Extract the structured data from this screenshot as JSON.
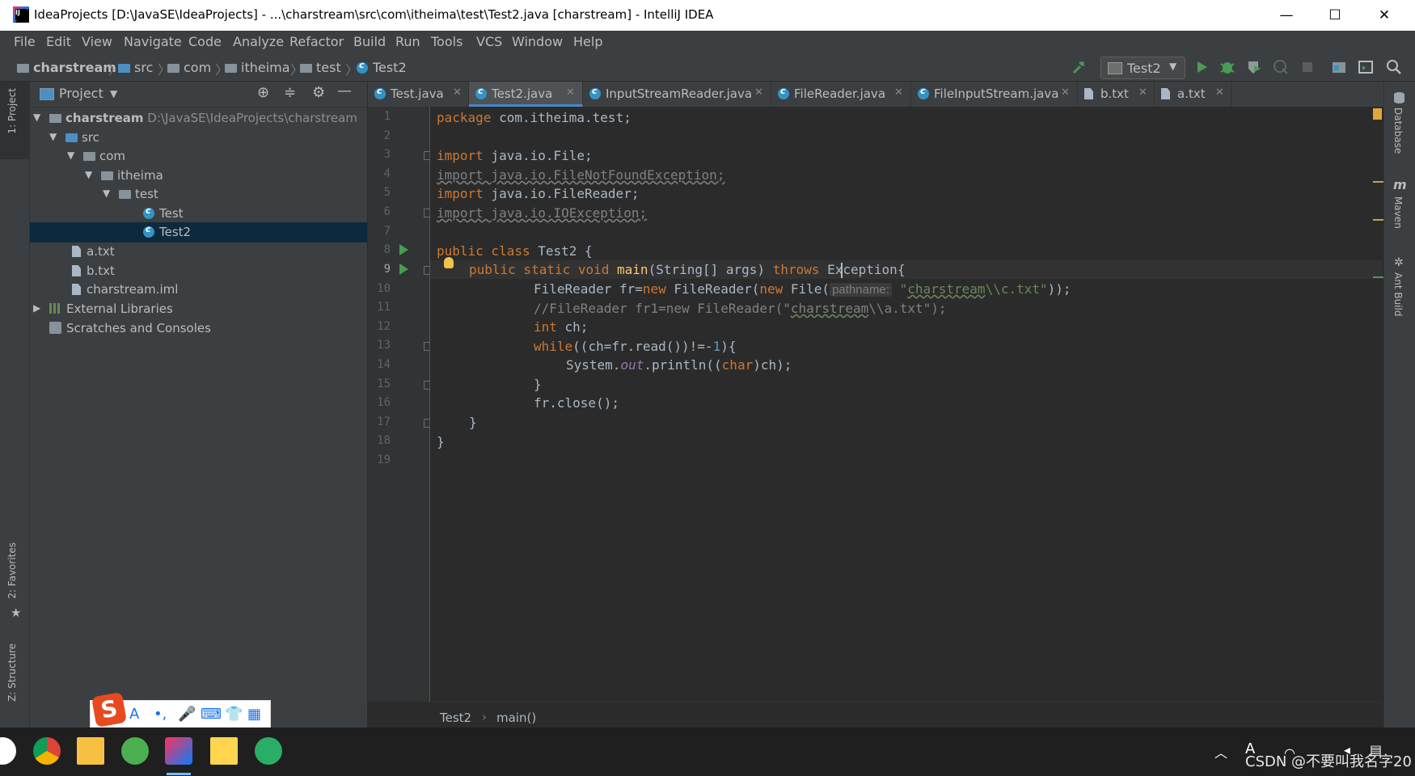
{
  "window": {
    "title": "IdeaProjects [D:\\JavaSE\\IdeaProjects] - ...\\charstream\\src\\com\\itheima\\test\\Test2.java [charstream] - IntelliJ IDEA",
    "minimize": "—",
    "maximize": "☐",
    "close": "✕"
  },
  "menu": [
    "File",
    "Edit",
    "View",
    "Navigate",
    "Code",
    "Analyze",
    "Refactor",
    "Build",
    "Run",
    "Tools",
    "VCS",
    "Window",
    "Help"
  ],
  "breadcrumb": [
    "charstream",
    "src",
    "com",
    "itheima",
    "test",
    "Test2"
  ],
  "toolbar": {
    "run_config": "Test2"
  },
  "left_tabs": {
    "project": "1: Project",
    "favorites": "2: Favorites",
    "structure": "Z: Structure"
  },
  "right_tabs": {
    "database": "Database",
    "maven": "Maven",
    "ant": "Ant Build"
  },
  "project_panel": {
    "title": "Project",
    "tree": [
      {
        "label": "charstream",
        "extra": "D:\\JavaSE\\IdeaProjects\\charstream"
      },
      {
        "label": "src"
      },
      {
        "label": "com"
      },
      {
        "label": "itheima"
      },
      {
        "label": "test"
      },
      {
        "label": "Test"
      },
      {
        "label": "Test2"
      },
      {
        "label": "a.txt"
      },
      {
        "label": "b.txt"
      },
      {
        "label": "charstream.iml"
      },
      {
        "label": "External Libraries"
      },
      {
        "label": "Scratches and Consoles"
      }
    ]
  },
  "tabs": [
    "Test.java",
    "Test2.java",
    "InputStreamReader.java",
    "FileReader.java",
    "FileInputStream.java",
    "b.txt",
    "a.txt"
  ],
  "active_tab": "Test2.java",
  "line_numbers": [
    "1",
    "2",
    "3",
    "4",
    "5",
    "6",
    "7",
    "8",
    "9",
    "10",
    "11",
    "12",
    "13",
    "14",
    "15",
    "16",
    "17",
    "18",
    "19"
  ],
  "code": {
    "l1_kw": "package",
    "l1_rest": " com.itheima.test;",
    "import": "import",
    "l3": " java.io.File;",
    "l4": "import java.io.FileNotFoundException;",
    "l5": " java.io.FileReader;",
    "l6": "import java.io.IOException;",
    "l8_kw": "public class",
    "l8_rest": " Test2 {",
    "l9_kw1": "public static void",
    "l9_fn": "main",
    "l9_mid": "(String[] args) ",
    "l9_kw2": "throws",
    "l9_rest": " Exception{",
    "l10_a": "FileReader fr=",
    "new": "new",
    "l10_b": " FileReader(",
    "l10_c": " File(",
    "l10_hint": "pathname:",
    "l10_q1": "\"",
    "l10_str1": "charstream",
    "l10_str2": "\\\\c.txt\"",
    "l10_end": "));",
    "l11_a": "//FileReader fr1=new FileReader(\"",
    "l11_b": "charstream",
    "l11_c": "\\\\a.txt\");",
    "l12_kw": "int",
    "l12_rest": " ch;",
    "l13_kw": "while",
    "l13_a": "((ch=fr.read())!=-",
    "l13_num": "1",
    "l13_b": "){",
    "l14_a": "System.",
    "l14_out": "out",
    "l14_b": ".println((",
    "l14_kw": "char",
    "l14_c": ")ch);",
    "l15": "}",
    "l16": "fr.close();",
    "l17": "}",
    "l18": "}"
  },
  "editor_breadcrumb": [
    "Test2",
    "main()"
  ],
  "watermark": "CSDN @不要叫我名字20",
  "ime": {
    "logo": "S"
  }
}
